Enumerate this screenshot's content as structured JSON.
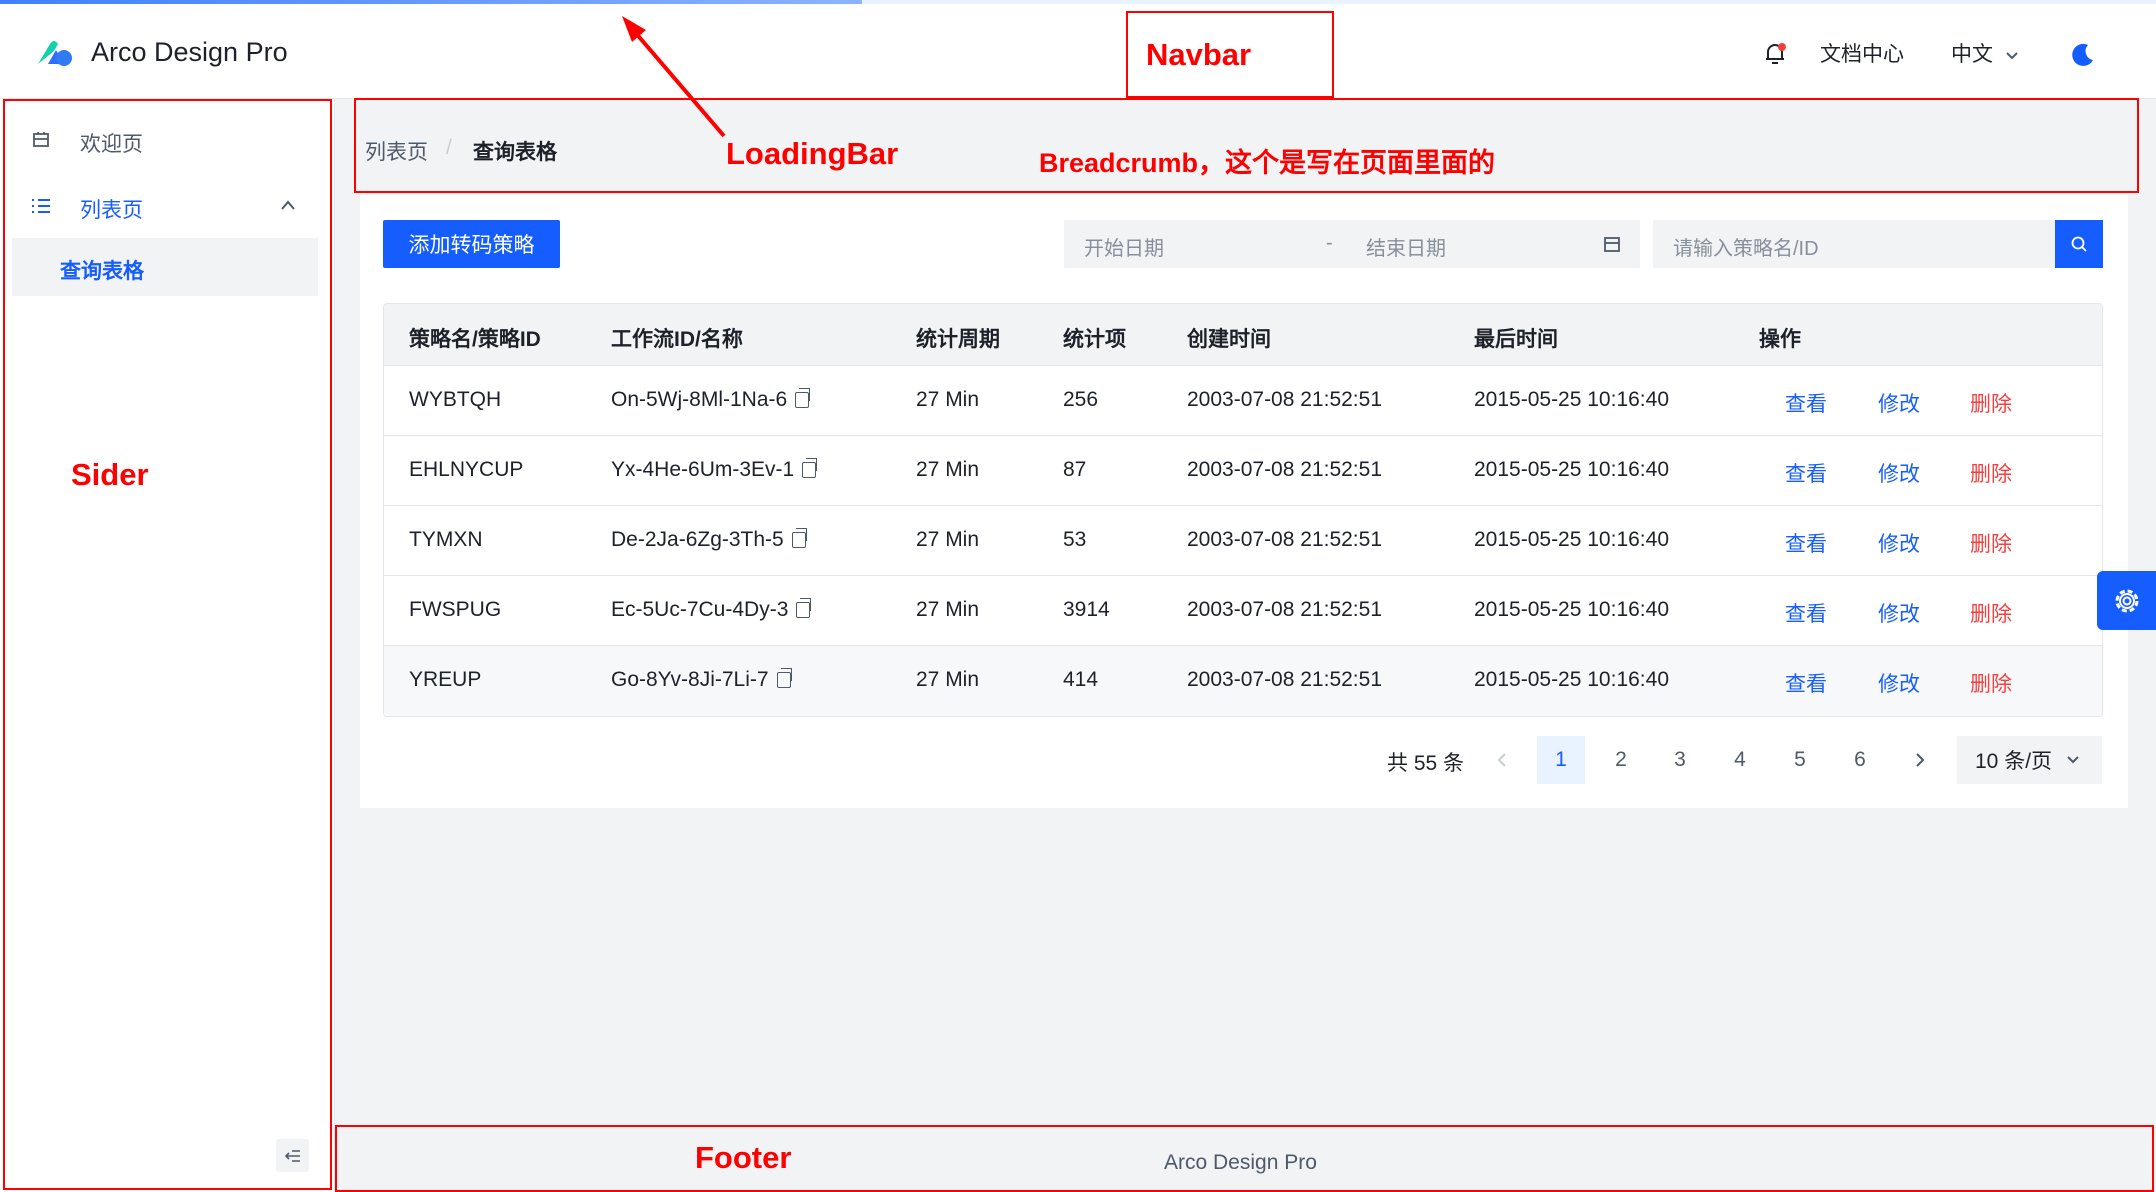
{
  "navbar": {
    "brand": "Arco Design Pro",
    "docs_link": "文档中心",
    "language": "中文"
  },
  "sider": {
    "items": [
      {
        "label": "欢迎页"
      },
      {
        "label": "列表页"
      }
    ],
    "sub_items": [
      {
        "label": "查询表格"
      }
    ]
  },
  "breadcrumb": {
    "items": [
      "列表页",
      "查询表格"
    ],
    "separator": "/"
  },
  "toolbar": {
    "add_button": "添加转码策略",
    "start_date_placeholder": "开始日期",
    "date_separator": "-",
    "end_date_placeholder": "结束日期",
    "search_placeholder": "请输入策略名/ID"
  },
  "table": {
    "headers": [
      "策略名/策略ID",
      "工作流ID/名称",
      "统计周期",
      "统计项",
      "创建时间",
      "最后时间",
      "操作"
    ],
    "rows": [
      {
        "name": "WYBTQH",
        "workflow": "On-5Wj-8Ml-1Na-6",
        "period": "27 Min",
        "count": "256",
        "created": "2003-07-08 21:52:51",
        "last": "2015-05-25 10:16:40"
      },
      {
        "name": "EHLNYCUP",
        "workflow": "Yx-4He-6Um-3Ev-1",
        "period": "27 Min",
        "count": "87",
        "created": "2003-07-08 21:52:51",
        "last": "2015-05-25 10:16:40"
      },
      {
        "name": "TYMXN",
        "workflow": "De-2Ja-6Zg-3Th-5",
        "period": "27 Min",
        "count": "53",
        "created": "2003-07-08 21:52:51",
        "last": "2015-05-25 10:16:40"
      },
      {
        "name": "FWSPUG",
        "workflow": "Ec-5Uc-7Cu-4Dy-3",
        "period": "27 Min",
        "count": "3914",
        "created": "2003-07-08 21:52:51",
        "last": "2015-05-25 10:16:40"
      },
      {
        "name": "YREUP",
        "workflow": "Go-8Yv-8Ji-7Li-7",
        "period": "27 Min",
        "count": "414",
        "created": "2003-07-08 21:52:51",
        "last": "2015-05-25 10:16:40"
      }
    ],
    "actions": {
      "view": "查看",
      "edit": "修改",
      "delete": "删除"
    }
  },
  "pagination": {
    "total": "共 55 条",
    "pages": [
      "1",
      "2",
      "3",
      "4",
      "5",
      "6"
    ],
    "current": "1",
    "page_size": "10 条/页"
  },
  "footer": {
    "text": "Arco Design Pro"
  },
  "annotations": {
    "navbar": "Navbar",
    "loadingbar": "LoadingBar",
    "breadcrumb": "Breadcrumb，这个是写在页面里面的",
    "sider": "Sider",
    "footer": "Footer"
  },
  "colors": {
    "primary": "#165dff",
    "danger": "#f53f3f",
    "annotation": "#ff0000"
  }
}
